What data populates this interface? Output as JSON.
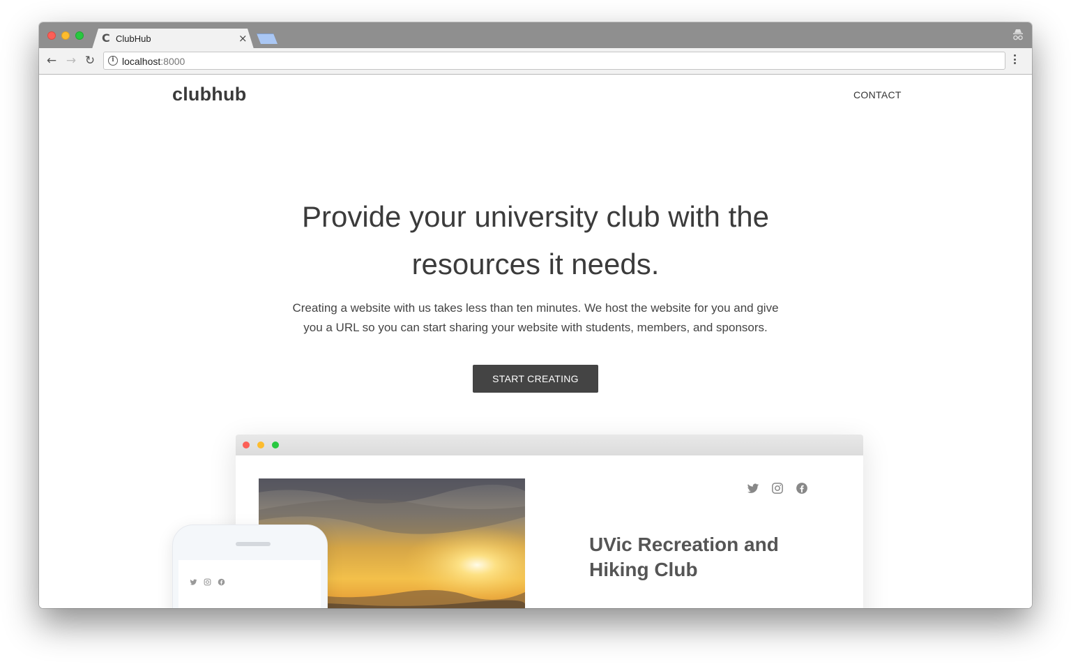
{
  "browser": {
    "tab_title": "ClubHub",
    "tab_favicon": "C",
    "tab_close": "×",
    "url_host": "localhost",
    "url_port": ":8000",
    "icons": [
      "back-icon",
      "forward-icon",
      "reload-icon",
      "info-icon",
      "star-icon",
      "menu-icon",
      "incognito-icon"
    ]
  },
  "site": {
    "logo": "clubhub",
    "nav": {
      "contact": "CONTACT"
    },
    "hero": {
      "title": "Provide your university club with the resources it needs.",
      "subtitle": "Creating a website with us takes less than ten minutes. We host the website for you and give you a URL so you can start sharing your website with students, members, and sponsors.",
      "cta": "START CREATING"
    },
    "preview": {
      "club_title": "UVic Recreation and Hiking Club",
      "social_icons": [
        "twitter-icon",
        "instagram-icon",
        "facebook-icon"
      ],
      "image": "sunset-landscape"
    }
  },
  "colors": {
    "titlebar": "#8f8f8f",
    "toolbar": "#f2f2f2",
    "button": "#444444",
    "text": "#3b3b3b"
  }
}
